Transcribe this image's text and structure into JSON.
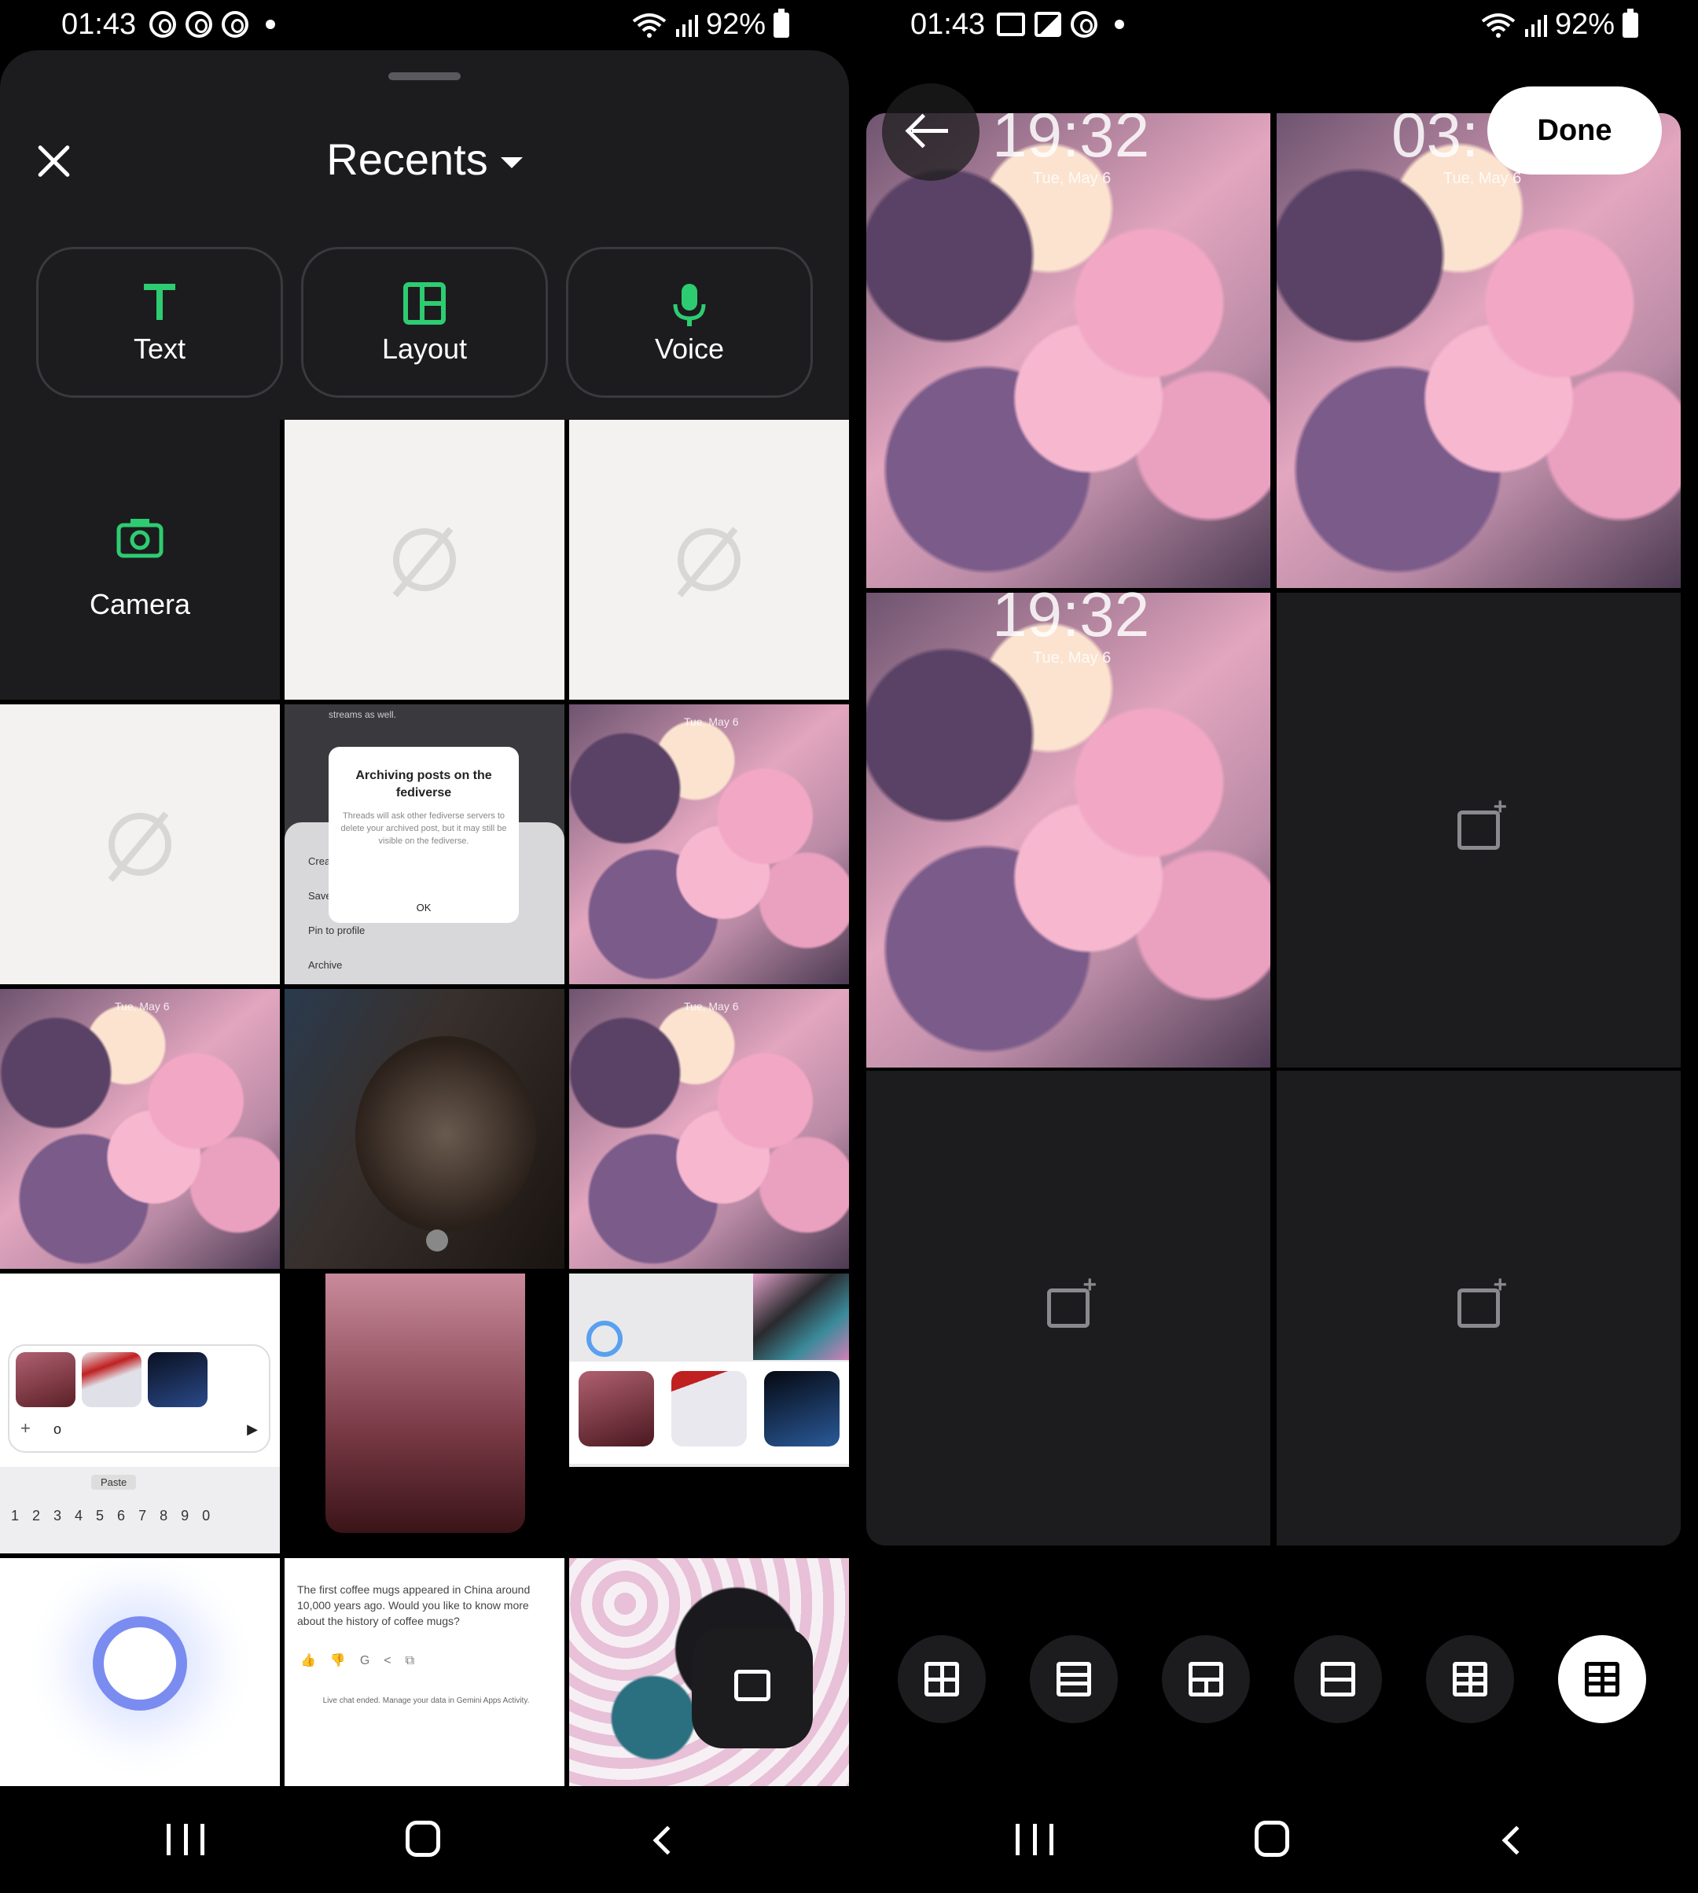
{
  "left": {
    "status": {
      "time": "01:43",
      "battery": "92%"
    },
    "sheet": {
      "title": "Recents",
      "options": [
        {
          "label": "Text",
          "icon": "text-icon"
        },
        {
          "label": "Layout",
          "icon": "layout-icon"
        },
        {
          "label": "Voice",
          "icon": "mic-icon"
        }
      ],
      "camera_label": "Camera"
    },
    "thumbs": {
      "dialog_title": "Archiving posts on the fediverse",
      "dialog_body": "Threads will ask other fediverse servers to delete your archived post, but it may still be visible on the fediverse.",
      "dialog_ok": "OK",
      "dialog_menu": [
        "Crea",
        "Save",
        "Pin to profile",
        "Archive"
      ],
      "dialog_top": "streams as well.",
      "keyboard_paste": "Paste",
      "keyboard_digits": "1 2 3 4 5 6 7 8 9 0",
      "input_text": "o",
      "chat_text": "The first coffee mugs appeared in China around 10,000 years ago. Would you like to know more about the history of coffee mugs?",
      "chat_footer": "Live chat ended. Manage your data in Gemini Apps Activity.",
      "lock_date": "Tue, May 6"
    }
  },
  "right": {
    "status": {
      "time": "01:43",
      "battery": "92%"
    },
    "done_label": "Done",
    "clock_1": "19:32",
    "clock_2": "03:",
    "clock_3": "19:32",
    "date": "Tue, May 6"
  },
  "accent": "#2ecc71"
}
